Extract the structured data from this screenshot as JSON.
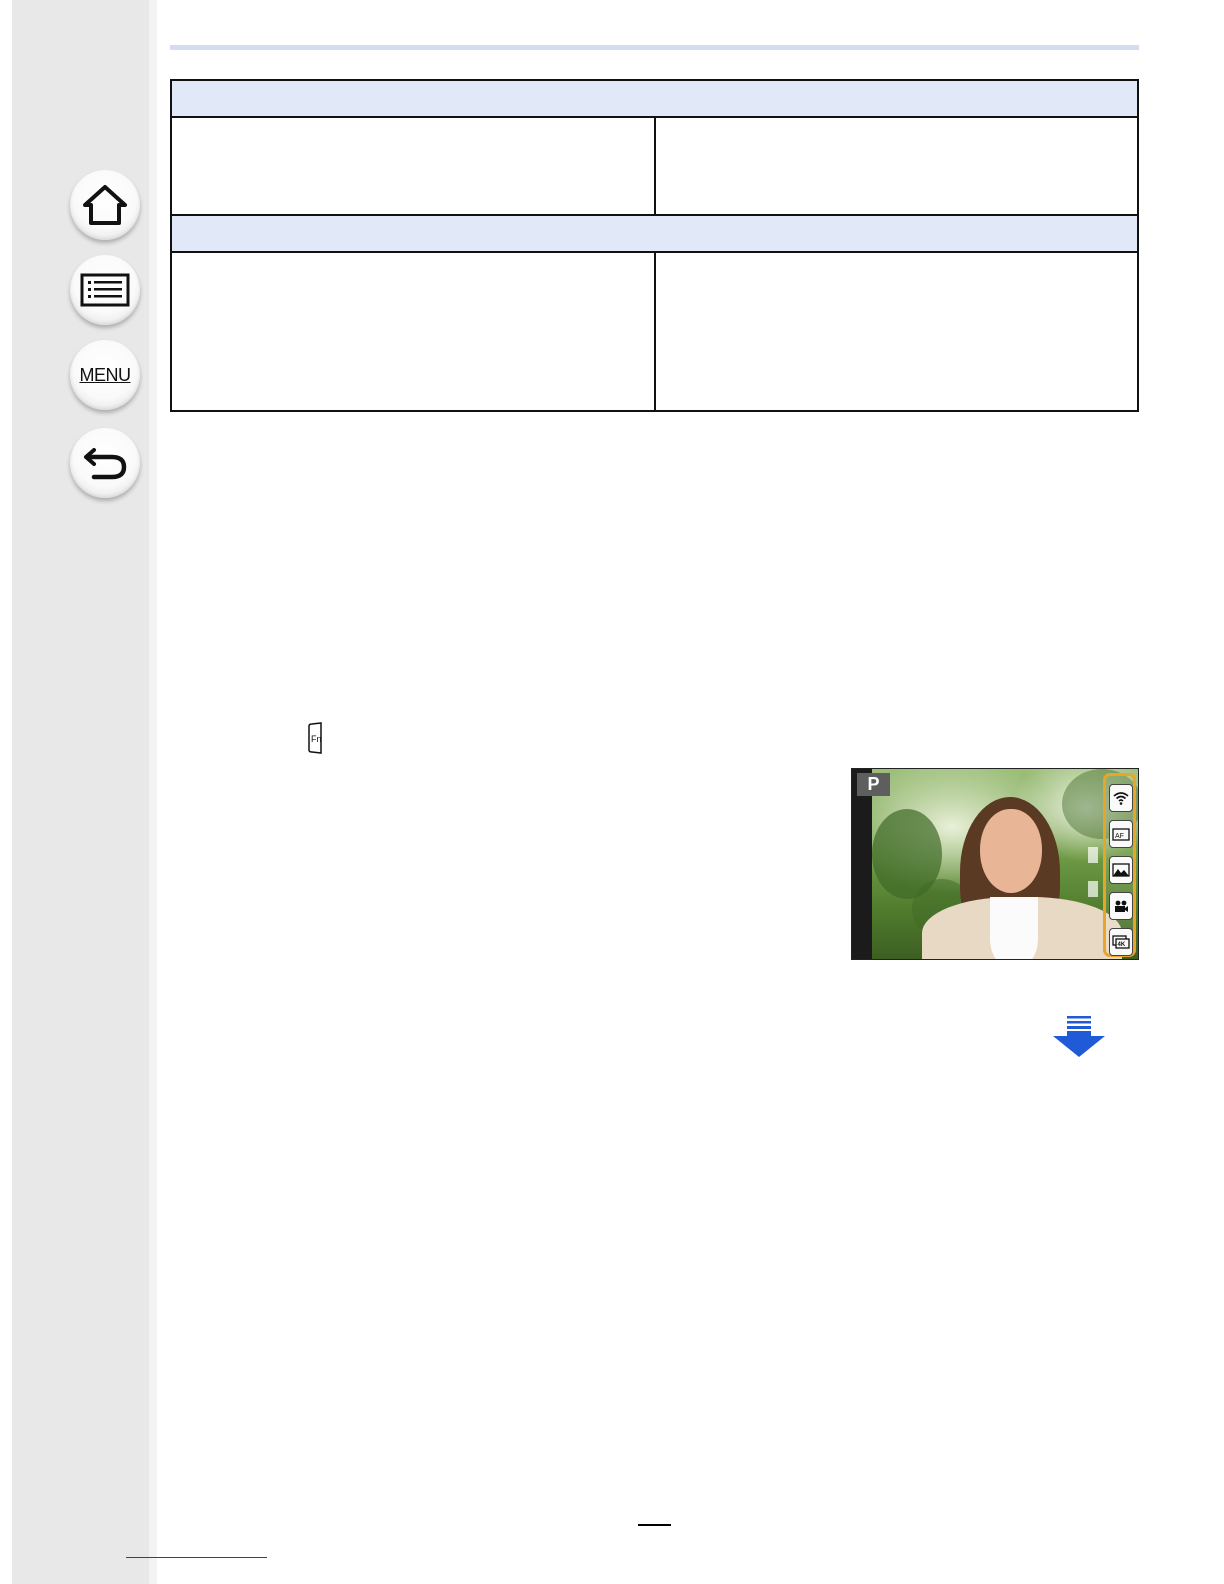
{
  "nav": {
    "items": [
      {
        "name": "home-icon"
      },
      {
        "name": "contents-list-icon"
      },
      {
        "name": "menu-icon",
        "label": "MENU"
      },
      {
        "name": "back-icon"
      }
    ]
  },
  "table": {
    "rows": [
      {
        "type": "header",
        "text": ""
      },
      {
        "type": "cells",
        "left": "",
        "right": ""
      },
      {
        "type": "header",
        "text": ""
      },
      {
        "type": "cells",
        "left": "",
        "right": ""
      }
    ]
  },
  "fn_icon": {
    "label": "Fn"
  },
  "camera_screen": {
    "mode": "P",
    "tabs": [
      "wifi-icon",
      "touch-af-icon",
      "scenery-icon",
      "movie-icon",
      "4k-photo-icon"
    ],
    "colors": {
      "tab_frame": "#e8a52a",
      "mode_badge": "#5e5e5e"
    }
  },
  "next_page_icon": "next-page-arrow-icon",
  "colors": {
    "accent_blue": "#1f5bd6",
    "table_header": "#e1e8f7",
    "nav_strip": "#e8e8e8"
  }
}
